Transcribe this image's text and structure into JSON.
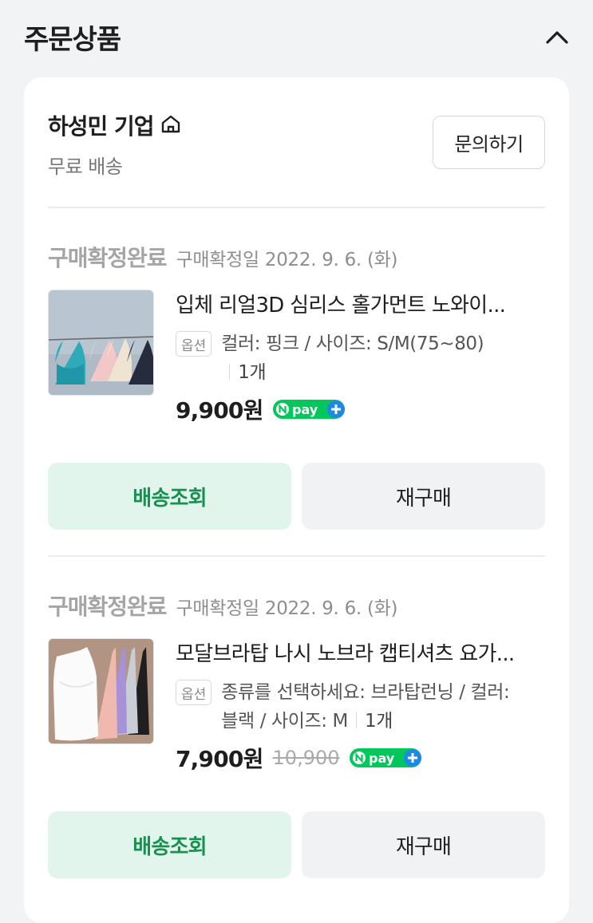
{
  "section": {
    "title": "주문상품"
  },
  "seller": {
    "name": "하성민 기업",
    "shipping": "무료 배송",
    "inquiry_label": "문의하기"
  },
  "orders": [
    {
      "status": "구매확정완료",
      "confirm_date": "구매확정일 2022. 9. 6. (화)",
      "product_name": "입체 리얼3D 심리스 홀가먼트 노와이...",
      "option_badge": "옵션",
      "option_text": "컬러: 핑크 / 사이즈: S/M(75~80)",
      "quantity": "1개",
      "price": "9,900원",
      "original_price": "",
      "track_label": "배송조회",
      "rebuy_label": "재구매"
    },
    {
      "status": "구매확정완료",
      "confirm_date": "구매확정일 2022. 9. 6. (화)",
      "product_name": "모달브라탑 나시 노브라 캡티셔츠 요가...",
      "option_badge": "옵션",
      "option_text_line1": "종류를 선택하세요: 브라탑런닝 / 컬러:",
      "option_text_line2": "블랙 / 사이즈: M",
      "quantity": "1개",
      "price": "7,900원",
      "original_price": "10,900",
      "track_label": "배송조회",
      "rebuy_label": "재구매"
    }
  ],
  "npay_label": "pay",
  "colors": {
    "accent_green": "#179150",
    "npay_green": "#03c75a",
    "npay_blue": "#1e88e5"
  }
}
